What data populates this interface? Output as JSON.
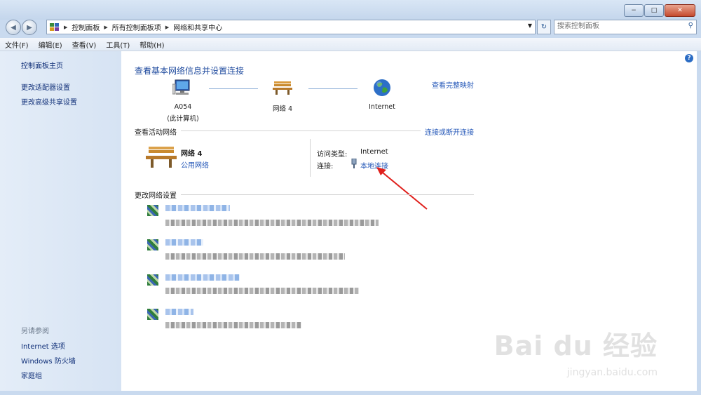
{
  "window": {
    "minimize": "−",
    "maximize": "□",
    "close": "✕"
  },
  "nav": {
    "back": "◀",
    "forward": "▶",
    "breadcrumb": [
      "控制面板",
      "所有控制面板项",
      "网络和共享中心"
    ],
    "search_placeholder": "搜索控制面板"
  },
  "menu": [
    "文件(F)",
    "编辑(E)",
    "查看(V)",
    "工具(T)",
    "帮助(H)"
  ],
  "sidebar": {
    "home": "控制面板主页",
    "links": [
      "更改适配器设置",
      "更改高级共享设置"
    ],
    "see_also_title": "另请参阅",
    "see_also": [
      "Internet 选项",
      "Windows 防火墙",
      "家庭组"
    ]
  },
  "main": {
    "title": "查看基本网络信息并设置连接",
    "full_map": "查看完整映射",
    "nodes": {
      "computer_name": "A054",
      "computer_note": "(此计算机)",
      "network": "网络  4",
      "internet": "Internet"
    },
    "active_title": "查看活动网络",
    "connect_link": "连接或断开连接",
    "active": {
      "name": "网络  4",
      "type": "公用网络",
      "access_label": "访问类型:",
      "access_value": "Internet",
      "conn_label": "连接:",
      "conn_value": "本地连接"
    },
    "change_title": "更改网络设置"
  },
  "watermark": {
    "logo": "Bai du 经验",
    "url": "jingyan.baidu.com"
  },
  "colors": {
    "link": "#2457b8",
    "title": "#1e4a9e",
    "arrow": "#e0201c"
  }
}
